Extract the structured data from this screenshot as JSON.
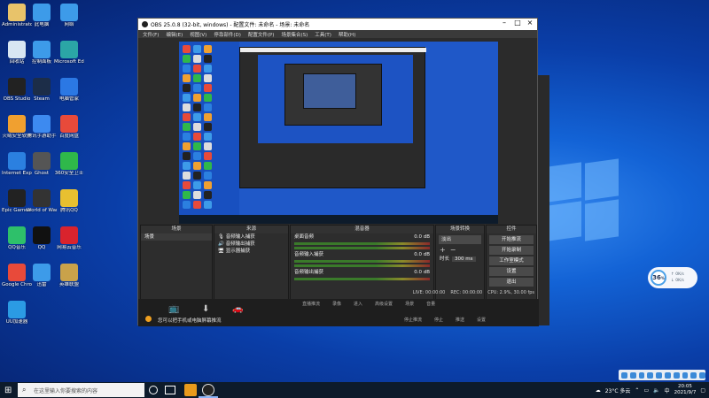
{
  "desktop_icons": [
    {
      "label": "Administrator",
      "color": "#e8c36a"
    },
    {
      "label": "此电脑",
      "color": "#3d9be9"
    },
    {
      "label": "网络",
      "color": "#3d9be9"
    },
    {
      "label": "回收站",
      "color": "#d8e6f2"
    },
    {
      "label": "控制面板",
      "color": "#3d9be9"
    },
    {
      "label": "Microsoft Edge",
      "color": "#2ba6a6"
    },
    {
      "label": "OBS Studio",
      "color": "#222"
    },
    {
      "label": "Steam",
      "color": "#1c2d48"
    },
    {
      "label": "电脑管家",
      "color": "#2b78e4"
    },
    {
      "label": "火绒安全软件",
      "color": "#f0a030"
    },
    {
      "label": "腾讯手游助手",
      "color": "#3d8af0"
    },
    {
      "label": "百度网盘",
      "color": "#e84a3a"
    },
    {
      "label": "Internet Explorer",
      "color": "#2b80e0"
    },
    {
      "label": "Ghost",
      "color": "#555"
    },
    {
      "label": "360安全卫士",
      "color": "#2fb84a"
    },
    {
      "label": "Epic Games Launcher",
      "color": "#222"
    },
    {
      "label": "World of Warcraft",
      "color": "#333"
    },
    {
      "label": "腾讯QQ",
      "color": "#e8c030"
    },
    {
      "label": "QQ音乐",
      "color": "#2ec06a"
    },
    {
      "label": "QQ",
      "color": "#111"
    },
    {
      "label": "网易云音乐",
      "color": "#d9232d"
    },
    {
      "label": "Google Chrome",
      "color": "#e84a3a"
    },
    {
      "label": "迅雷",
      "color": "#3d9be9"
    },
    {
      "label": "英雄联盟",
      "color": "#c9a24a"
    },
    {
      "label": "UU加速器",
      "color": "#2b9be4"
    }
  ],
  "obs": {
    "title": "OBS 25.0.8 (32-bit, windows) - 配置文件: 未命名 - 场景: 未命名",
    "menu": [
      "文件(F)",
      "编辑(E)",
      "视图(V)",
      "停靠部件(D)",
      "配置文件(P)",
      "场景集合(S)",
      "工具(T)",
      "帮助(H)"
    ],
    "docks": {
      "scenes": {
        "title": "场景",
        "items": [
          "场景"
        ]
      },
      "sources": {
        "title": "来源",
        "items": [
          "音频输入捕获",
          "音频输出捕获",
          "显示器捕获"
        ]
      },
      "mixer": {
        "title": "混音器",
        "tracks": [
          {
            "name": "桌面音频",
            "db": "0.0 dB"
          },
          {
            "name": "音频输入捕获",
            "db": "0.0 dB"
          },
          {
            "name": "音频输出捕获",
            "db": "0.0 dB"
          }
        ]
      },
      "transitions": {
        "title": "场景转换",
        "type": "淡出",
        "duration_label": "时长",
        "duration": "300 ms"
      },
      "controls": {
        "title": "控件",
        "buttons": [
          "开始推流",
          "开始录制",
          "工作室模式",
          "设置",
          "退出"
        ]
      }
    },
    "status": {
      "live": "LIVE: 00:00:00",
      "rec": "REC: 00:00:00",
      "cpu": "CPU: 2.9%, 30.00 fps"
    },
    "lower_labels": [
      "直播推流",
      "录像",
      "进入",
      "高级设置",
      "场景",
      "音量"
    ],
    "lower_right_labels": [
      "停止推流",
      "停止",
      "推送",
      "设置"
    ],
    "notice": "您可以把手机或电脑屏幕推流"
  },
  "speed_widget": {
    "value": "36",
    "unit": "%",
    "up": "↑ 0K/s",
    "down": "↓ 0K/s"
  },
  "taskbar": {
    "search_placeholder": "在这里输入你要搜索的内容",
    "weather": "23°C 多云",
    "time": "20:05",
    "date": "2021/9/7",
    "ime": "中"
  }
}
